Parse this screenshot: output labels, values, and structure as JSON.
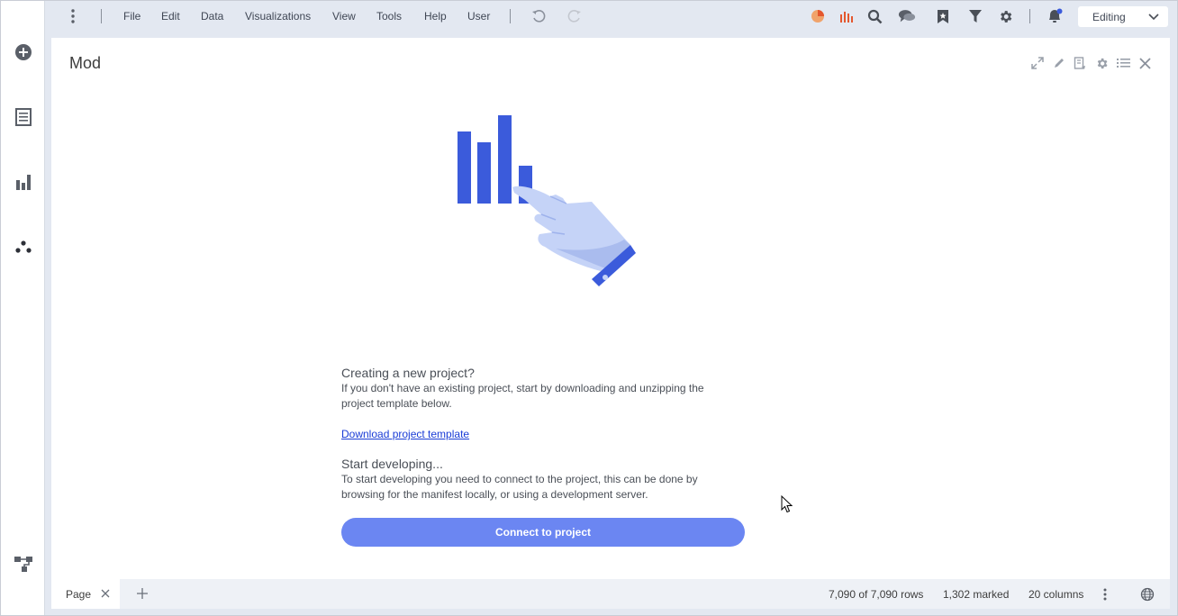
{
  "menu": {
    "items": [
      {
        "label": "File"
      },
      {
        "label": "Edit"
      },
      {
        "label": "Data"
      },
      {
        "label": "Visualizations"
      },
      {
        "label": "View"
      },
      {
        "label": "Tools"
      },
      {
        "label": "Help"
      },
      {
        "label": "User"
      }
    ]
  },
  "toolbar": {
    "mode_value": "Editing",
    "icons": [
      "pie-icon",
      "bar-chart-icon",
      "search-icon",
      "chat-icon",
      "bookmark-icon",
      "filter-icon",
      "gear-icon",
      "notification-icon"
    ]
  },
  "left_rail": {
    "icons": [
      "add-icon",
      "data-table-icon",
      "visualization-icon",
      "analytics-icon",
      "data-canvas-icon"
    ]
  },
  "panel": {
    "title": "Mod",
    "tools": [
      "maximize-icon",
      "edit-icon",
      "export-icon",
      "settings-icon",
      "list-icon",
      "close-icon"
    ],
    "section1_title": "Creating a new project?",
    "section1_text": "If you don't have an existing project, start by downloading and unzipping the project template below.",
    "download_link": "Download project template",
    "section2_title": "Start developing...",
    "section2_text": "To start developing you need to connect to the project, this can be done by browsing for the manifest locally, or using a development server.",
    "connect_button": "Connect to project"
  },
  "statusbar": {
    "page_tab": "Page",
    "rows": "7,090 of 7,090 rows",
    "marked": "1,302 marked",
    "columns": "20 columns"
  },
  "colors": {
    "accent": "#6b86f2",
    "bar": "#3b5bdb",
    "link": "#1a3cd6",
    "chrome": "#e3e8f1"
  }
}
